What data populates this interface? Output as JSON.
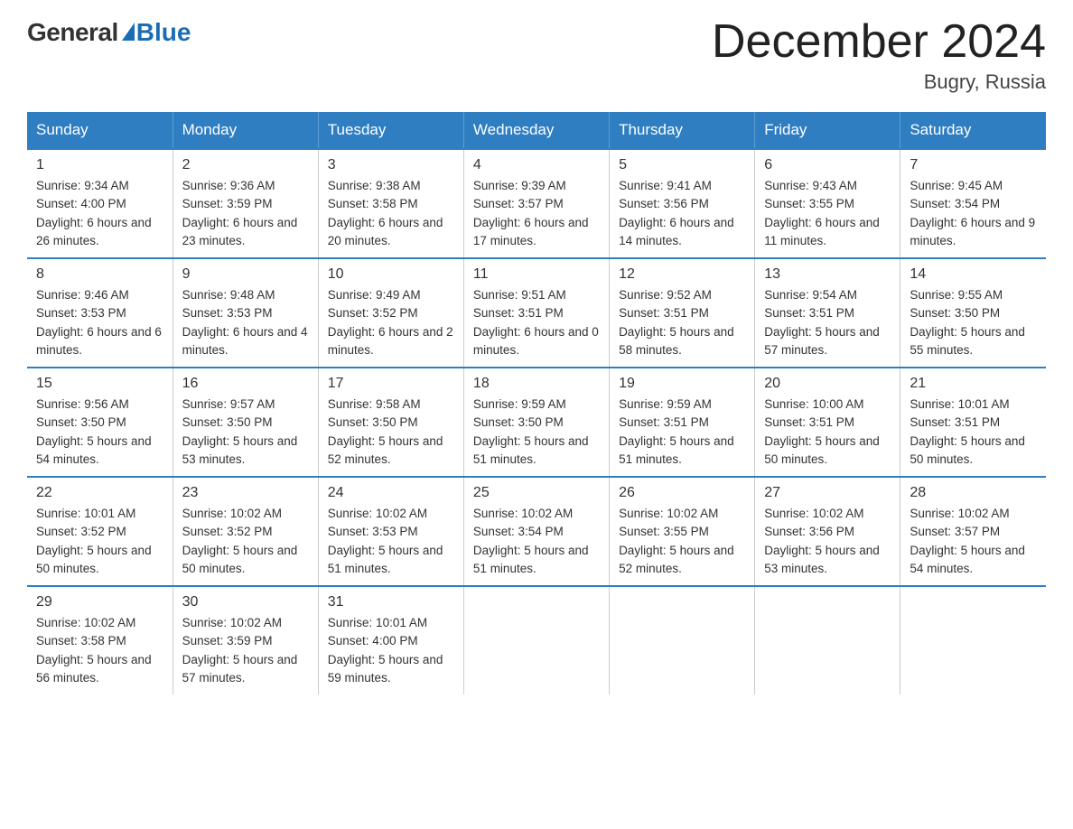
{
  "logo": {
    "general": "General",
    "blue": "Blue"
  },
  "title": "December 2024",
  "location": "Bugry, Russia",
  "weekdays": [
    "Sunday",
    "Monday",
    "Tuesday",
    "Wednesday",
    "Thursday",
    "Friday",
    "Saturday"
  ],
  "weeks": [
    [
      {
        "num": "1",
        "sunrise": "9:34 AM",
        "sunset": "4:00 PM",
        "daylight": "6 hours and 26 minutes."
      },
      {
        "num": "2",
        "sunrise": "9:36 AM",
        "sunset": "3:59 PM",
        "daylight": "6 hours and 23 minutes."
      },
      {
        "num": "3",
        "sunrise": "9:38 AM",
        "sunset": "3:58 PM",
        "daylight": "6 hours and 20 minutes."
      },
      {
        "num": "4",
        "sunrise": "9:39 AM",
        "sunset": "3:57 PM",
        "daylight": "6 hours and 17 minutes."
      },
      {
        "num": "5",
        "sunrise": "9:41 AM",
        "sunset": "3:56 PM",
        "daylight": "6 hours and 14 minutes."
      },
      {
        "num": "6",
        "sunrise": "9:43 AM",
        "sunset": "3:55 PM",
        "daylight": "6 hours and 11 minutes."
      },
      {
        "num": "7",
        "sunrise": "9:45 AM",
        "sunset": "3:54 PM",
        "daylight": "6 hours and 9 minutes."
      }
    ],
    [
      {
        "num": "8",
        "sunrise": "9:46 AM",
        "sunset": "3:53 PM",
        "daylight": "6 hours and 6 minutes."
      },
      {
        "num": "9",
        "sunrise": "9:48 AM",
        "sunset": "3:53 PM",
        "daylight": "6 hours and 4 minutes."
      },
      {
        "num": "10",
        "sunrise": "9:49 AM",
        "sunset": "3:52 PM",
        "daylight": "6 hours and 2 minutes."
      },
      {
        "num": "11",
        "sunrise": "9:51 AM",
        "sunset": "3:51 PM",
        "daylight": "6 hours and 0 minutes."
      },
      {
        "num": "12",
        "sunrise": "9:52 AM",
        "sunset": "3:51 PM",
        "daylight": "5 hours and 58 minutes."
      },
      {
        "num": "13",
        "sunrise": "9:54 AM",
        "sunset": "3:51 PM",
        "daylight": "5 hours and 57 minutes."
      },
      {
        "num": "14",
        "sunrise": "9:55 AM",
        "sunset": "3:50 PM",
        "daylight": "5 hours and 55 minutes."
      }
    ],
    [
      {
        "num": "15",
        "sunrise": "9:56 AM",
        "sunset": "3:50 PM",
        "daylight": "5 hours and 54 minutes."
      },
      {
        "num": "16",
        "sunrise": "9:57 AM",
        "sunset": "3:50 PM",
        "daylight": "5 hours and 53 minutes."
      },
      {
        "num": "17",
        "sunrise": "9:58 AM",
        "sunset": "3:50 PM",
        "daylight": "5 hours and 52 minutes."
      },
      {
        "num": "18",
        "sunrise": "9:59 AM",
        "sunset": "3:50 PM",
        "daylight": "5 hours and 51 minutes."
      },
      {
        "num": "19",
        "sunrise": "9:59 AM",
        "sunset": "3:51 PM",
        "daylight": "5 hours and 51 minutes."
      },
      {
        "num": "20",
        "sunrise": "10:00 AM",
        "sunset": "3:51 PM",
        "daylight": "5 hours and 50 minutes."
      },
      {
        "num": "21",
        "sunrise": "10:01 AM",
        "sunset": "3:51 PM",
        "daylight": "5 hours and 50 minutes."
      }
    ],
    [
      {
        "num": "22",
        "sunrise": "10:01 AM",
        "sunset": "3:52 PM",
        "daylight": "5 hours and 50 minutes."
      },
      {
        "num": "23",
        "sunrise": "10:02 AM",
        "sunset": "3:52 PM",
        "daylight": "5 hours and 50 minutes."
      },
      {
        "num": "24",
        "sunrise": "10:02 AM",
        "sunset": "3:53 PM",
        "daylight": "5 hours and 51 minutes."
      },
      {
        "num": "25",
        "sunrise": "10:02 AM",
        "sunset": "3:54 PM",
        "daylight": "5 hours and 51 minutes."
      },
      {
        "num": "26",
        "sunrise": "10:02 AM",
        "sunset": "3:55 PM",
        "daylight": "5 hours and 52 minutes."
      },
      {
        "num": "27",
        "sunrise": "10:02 AM",
        "sunset": "3:56 PM",
        "daylight": "5 hours and 53 minutes."
      },
      {
        "num": "28",
        "sunrise": "10:02 AM",
        "sunset": "3:57 PM",
        "daylight": "5 hours and 54 minutes."
      }
    ],
    [
      {
        "num": "29",
        "sunrise": "10:02 AM",
        "sunset": "3:58 PM",
        "daylight": "5 hours and 56 minutes."
      },
      {
        "num": "30",
        "sunrise": "10:02 AM",
        "sunset": "3:59 PM",
        "daylight": "5 hours and 57 minutes."
      },
      {
        "num": "31",
        "sunrise": "10:01 AM",
        "sunset": "4:00 PM",
        "daylight": "5 hours and 59 minutes."
      },
      null,
      null,
      null,
      null
    ]
  ]
}
